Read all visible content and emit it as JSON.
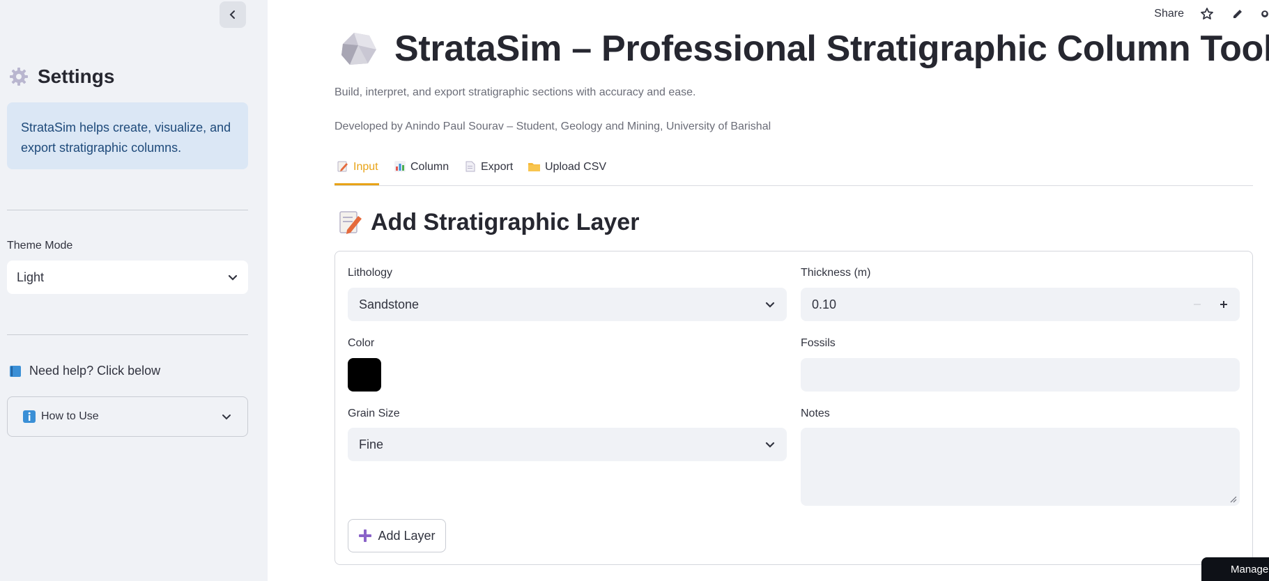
{
  "sidebar": {
    "title": "Settings",
    "title_icon": "gear-icon",
    "info_text": "StrataSim helps create, visualize, and export stratigraphic columns.",
    "theme_label": "Theme Mode",
    "theme_value": "Light",
    "help_heading": "Need help? Click below",
    "help_icon": "blue-book-icon",
    "expander_label": "How to Use",
    "expander_icon": "info-icon"
  },
  "toolbar": {
    "share_label": "Share",
    "icons": [
      "star-icon",
      "pencil-icon",
      "github-icon"
    ]
  },
  "header": {
    "title": "StrataSim – Professional Stratigraphic Column Tool",
    "title_icon": "rock-icon",
    "subtitle": "Build, interpret, and export stratigraphic sections with accuracy and ease.",
    "credit": "Developed by Anindo Paul Sourav – Student, Geology and Mining, University of Barishal"
  },
  "tabs": [
    {
      "label": "Input",
      "icon": "memo-icon",
      "active": true
    },
    {
      "label": "Column",
      "icon": "bar-chart-icon",
      "active": false
    },
    {
      "label": "Export",
      "icon": "page-icon",
      "active": false
    },
    {
      "label": "Upload CSV",
      "icon": "folder-icon",
      "active": false
    }
  ],
  "form": {
    "section_title": "Add Stratigraphic Layer",
    "section_icon": "memo-icon",
    "lithology_label": "Lithology",
    "lithology_value": "Sandstone",
    "thickness_label": "Thickness (m)",
    "thickness_value": "0.10",
    "color_label": "Color",
    "color_value": "#000000",
    "fossils_label": "Fossils",
    "fossils_value": "",
    "grain_label": "Grain Size",
    "grain_value": "Fine",
    "notes_label": "Notes",
    "notes_value": "",
    "add_button_label": "Add Layer"
  },
  "manage": {
    "label": "Manage app"
  },
  "colors": {
    "accent": "#e8a317",
    "sidebar_bg": "#f0f2f6",
    "info_bg": "#dbe7f5"
  }
}
